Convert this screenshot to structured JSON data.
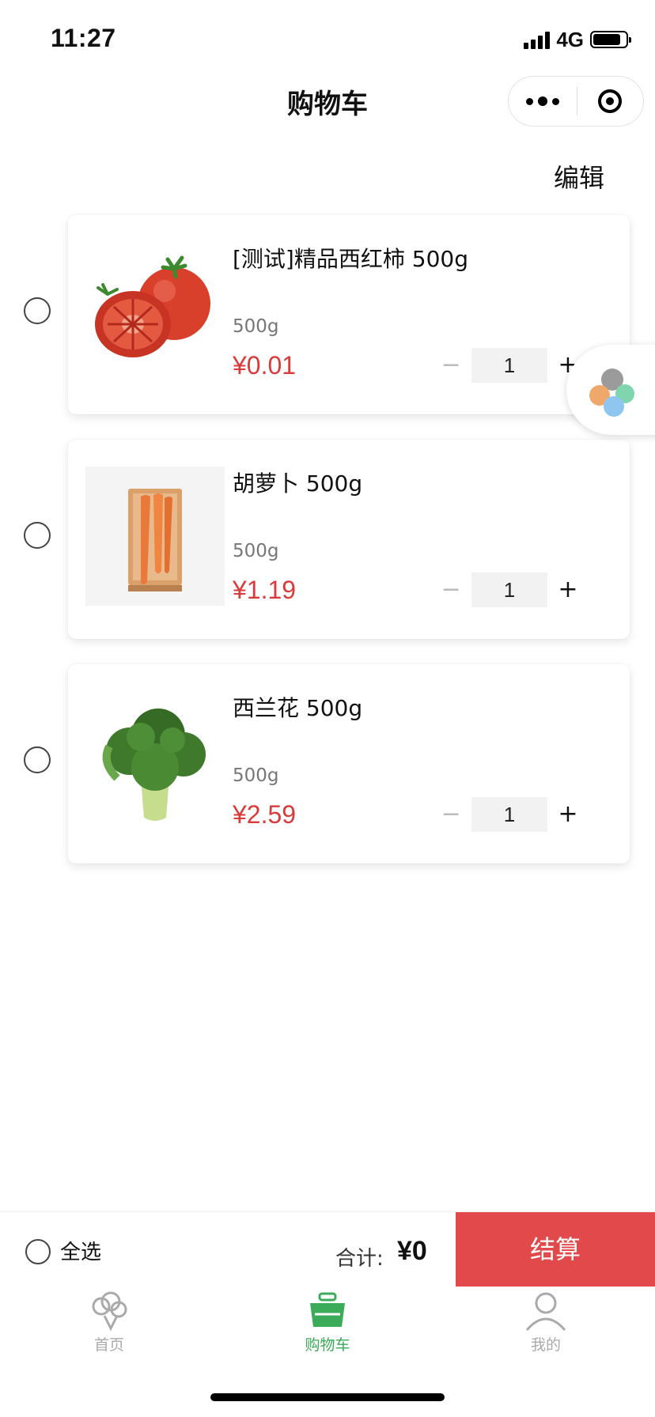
{
  "status_bar": {
    "time": "11:27",
    "network": "4G"
  },
  "nav": {
    "title": "购物车",
    "more_icon": "more-dots-icon",
    "close_icon": "target-icon"
  },
  "header": {
    "edit_label": "编辑"
  },
  "cart": {
    "items": [
      {
        "name": "[测试]精品西红柿 500g",
        "spec": "500g",
        "price": "¥0.01",
        "quantity": "1",
        "image": "tomato"
      },
      {
        "name": "胡萝卜 500g",
        "spec": "500g",
        "price": "¥1.19",
        "quantity": "1",
        "image": "carrot"
      },
      {
        "name": "西兰花 500g",
        "spec": "500g",
        "price": "¥2.59",
        "quantity": "1",
        "image": "broccoli"
      }
    ],
    "minus_symbol": "−",
    "plus_symbol": "+"
  },
  "checkout": {
    "select_all_label": "全选",
    "total_label": "合计:",
    "total_value": "¥0",
    "button_label": "结算"
  },
  "tabbar": {
    "items": [
      {
        "label": "首页",
        "icon": "broccoli-icon",
        "active": false
      },
      {
        "label": "购物车",
        "icon": "basket-icon",
        "active": true
      },
      {
        "label": "我的",
        "icon": "person-icon",
        "active": false
      }
    ]
  },
  "colors": {
    "accent_red": "#e2494a",
    "price_red": "#d93a3a",
    "active_green": "#3bab5a"
  }
}
